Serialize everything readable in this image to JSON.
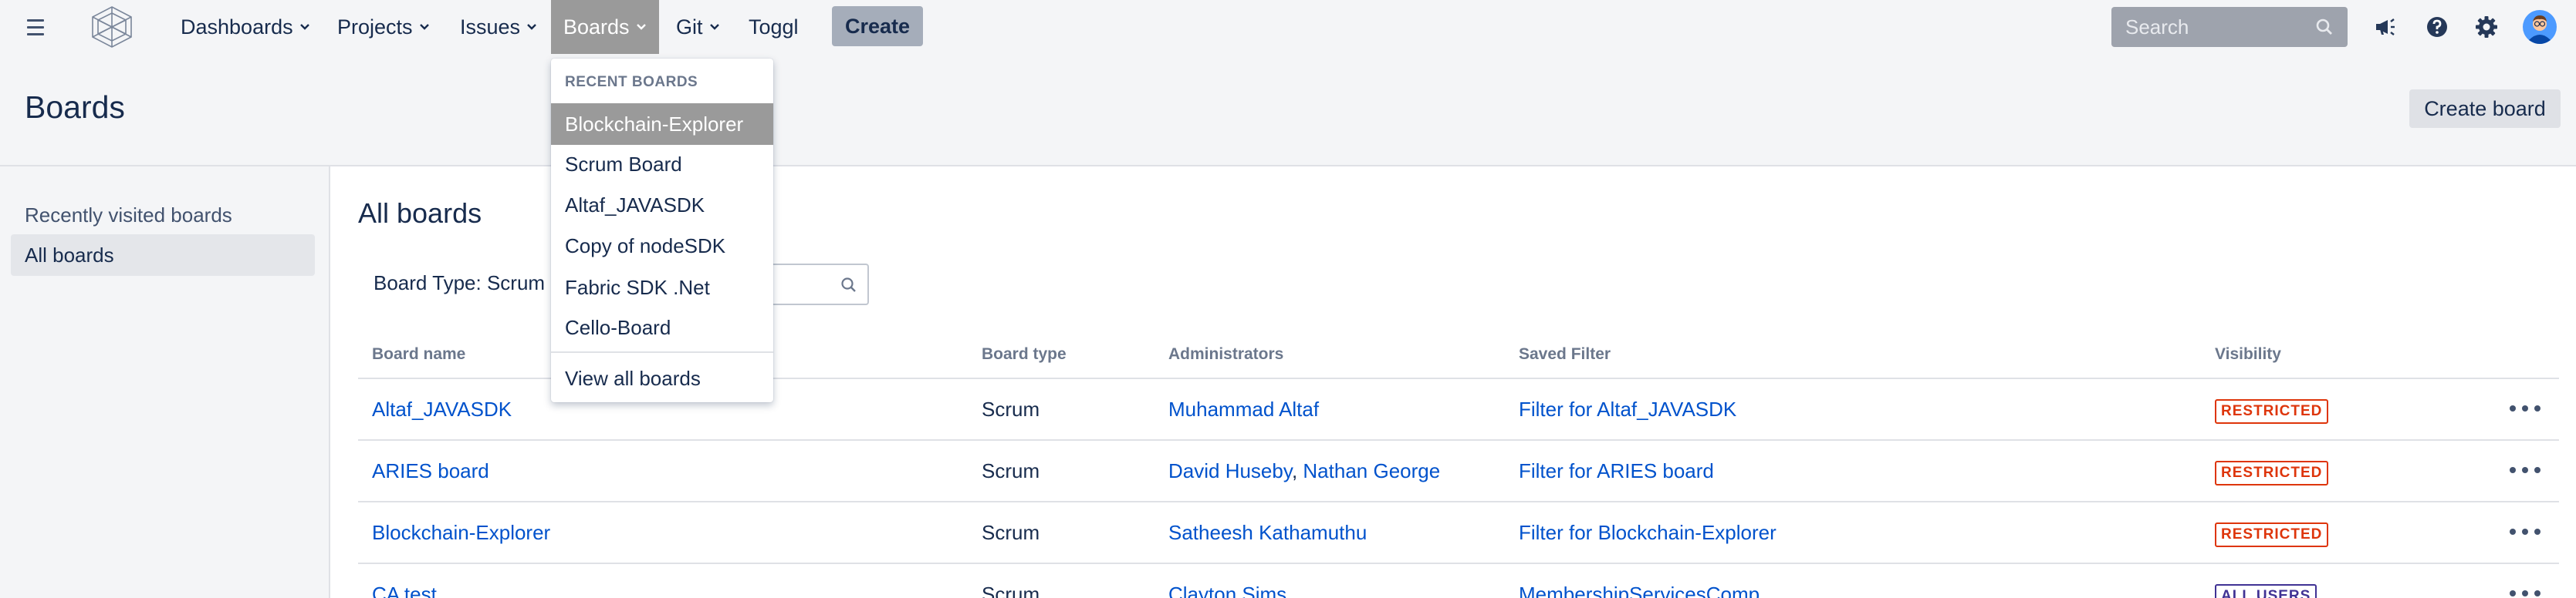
{
  "nav": {
    "items": [
      {
        "label": "Dashboards"
      },
      {
        "label": "Projects"
      },
      {
        "label": "Issues"
      },
      {
        "label": "Boards"
      },
      {
        "label": "Git"
      },
      {
        "label": "Toggl"
      }
    ],
    "create_label": "Create",
    "search_placeholder": "Search",
    "icons": [
      "menu-icon",
      "app-logo",
      "megaphone-icon",
      "help-icon",
      "gear-icon",
      "avatar"
    ],
    "active_color": "#9a9a9a"
  },
  "page": {
    "title": "Boards",
    "create_board_label": "Create board"
  },
  "sidebar": {
    "items": [
      {
        "label": "Recently visited boards"
      },
      {
        "label": "All boards"
      }
    ]
  },
  "main": {
    "title": "All boards",
    "filter_label": "Board Type: Scrum",
    "columns": [
      "Board name",
      "Board type",
      "Administrators",
      "Saved Filter",
      "Visibility"
    ],
    "rows": [
      {
        "name": "Altaf_JAVASDK",
        "type": "Scrum",
        "admins": [
          "Muhammad Altaf"
        ],
        "filter": "Filter for Altaf_JAVASDK",
        "visibility": "RESTRICTED"
      },
      {
        "name": "ARIES board",
        "type": "Scrum",
        "admins": [
          "David Huseby",
          "Nathan George"
        ],
        "filter": "Filter for ARIES board",
        "visibility": "RESTRICTED"
      },
      {
        "name": "Blockchain-Explorer",
        "type": "Scrum",
        "admins": [
          "Satheesh Kathamuthu"
        ],
        "filter": "Filter for Blockchain-Explorer",
        "visibility": "RESTRICTED"
      },
      {
        "name": "CA test",
        "type": "Scrum",
        "admins": [
          "Clayton Sims"
        ],
        "filter": "MembershipServicesComp",
        "visibility": "ALL USERS"
      }
    ],
    "admin_separator": ",",
    "restricted_color": "#de350b",
    "all_users_color": "#403294",
    "link_color": "#0052cc"
  },
  "dropdown": {
    "heading": "RECENT BOARDS",
    "items": [
      "Blockchain-Explorer",
      "Scrum Board",
      "Altaf_JAVASDK",
      "Copy of nodeSDK",
      "Fabric SDK .Net",
      "Cello-Board"
    ],
    "footer": "View all boards"
  }
}
